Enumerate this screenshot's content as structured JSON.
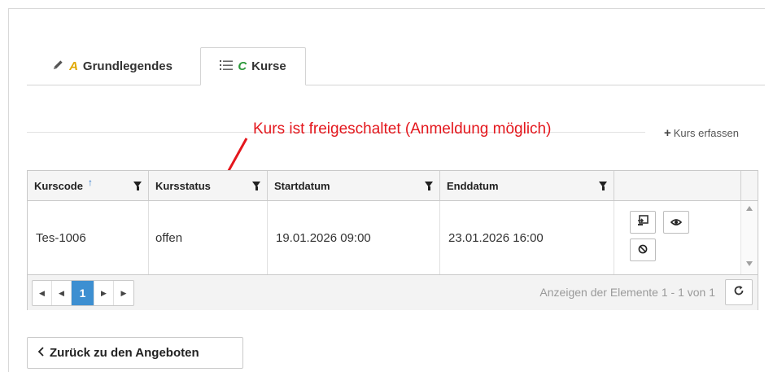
{
  "tabs": [
    {
      "label": "Grundlegendes",
      "badge": "A",
      "icon": "pencil-icon"
    },
    {
      "label": "Kurse",
      "badge": "C",
      "icon": "list-icon"
    }
  ],
  "actions": {
    "add_course": "Kurs erfassen"
  },
  "annotation": {
    "text": "Kurs ist freigeschaltet (Anmeldung möglich)",
    "color": "#e4171d"
  },
  "grid": {
    "columns": [
      {
        "label": "Kurscode",
        "sorted": "asc"
      },
      {
        "label": "Kursstatus"
      },
      {
        "label": "Startdatum"
      },
      {
        "label": "Enddatum"
      }
    ],
    "rows": [
      {
        "kurscode": "Tes-1006",
        "kursstatus": "offen",
        "startdatum": "19.01.2026 09:00",
        "enddatum": "23.01.2026 16:00",
        "row_actions": [
          "login-icon",
          "eye-icon",
          "disable-icon"
        ]
      }
    ]
  },
  "pager": {
    "current_page": "1",
    "info": "Anzeigen der Elemente 1 - 1 von 1",
    "active_color": "#3d8fd1"
  },
  "back_button": {
    "label": "Zurück zu den Angeboten"
  }
}
